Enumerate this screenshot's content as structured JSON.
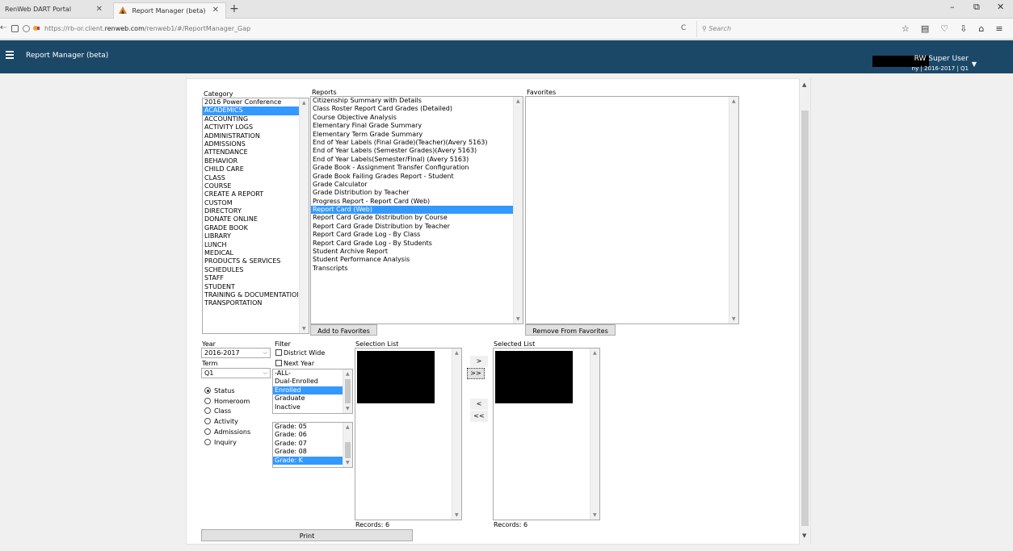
{
  "browser": {
    "tabs": [
      {
        "title": "RenWeb DART Portal"
      },
      {
        "title": "Report Manager (beta)"
      }
    ],
    "new_tab": "+",
    "url_prefix": "https://rb-or.client.",
    "url_domain": "renweb.com",
    "url_rest": "/renweb1/#/ReportManager_Gap",
    "reload": "C",
    "search_placeholder": "Search",
    "window_buttons": {
      "minimize": "–",
      "restore": "⧉",
      "close": "✕"
    }
  },
  "app": {
    "title": "Report Manager (beta)",
    "user_name": "RW Super User",
    "user_sub": "ny | 2016-2017 | Q1"
  },
  "category": {
    "label": "Category",
    "items": [
      "2016 Power Conference",
      "ACADEMICS",
      "ACCOUNTING",
      "ACTIVITY LOGS",
      "ADMINISTRATION",
      "ADMISSIONS",
      "ATTENDANCE",
      "BEHAVIOR",
      "CHILD CARE",
      "CLASS",
      "COURSE",
      "CREATE A REPORT",
      "CUSTOM",
      "DIRECTORY",
      "DONATE ONLINE",
      "GRADE BOOK",
      "LIBRARY",
      "LUNCH",
      "MEDICAL",
      "PRODUCTS & SERVICES",
      "SCHEDULES",
      "STAFF",
      "STUDENT",
      "TRAINING & DOCUMENTATIOI",
      "TRANSPORTATION"
    ],
    "selected": "ACADEMICS"
  },
  "reports": {
    "label": "Reports",
    "items": [
      "Citizenship Summary with Details",
      "Class Roster Report Card Grades (Detailed)",
      "Course Objective Analysis",
      "Elementary Final Grade Summary",
      "Elementary Term Grade Summary",
      "End of Year Labels (Final Grade)(Teacher)(Avery 5163)",
      "End of Year Labels (Semester Grades)(Avery 5163)",
      "End of Year Labels(Semester/Final) (Avery 5163)",
      "Grade Book - Assignment Transfer Configuration",
      "Grade Book Failing Grades Report - Student",
      "Grade Calculator",
      "Grade Distribution by Teacher",
      "Progress Report - Report Card (Web)",
      "Report Card (Web)",
      "Report Card Grade Distribution by Course",
      "Report Card Grade Distribution by Teacher",
      "Report Card Grade Log - By Class",
      "Report Card Grade Log - By Students",
      "Student Archive Report",
      "Student Performance Analysis",
      "Transcripts"
    ],
    "selected": "Report Card (Web)",
    "add_button": "Add to Favorites"
  },
  "favorites": {
    "label": "Favorites",
    "remove_button": "Remove From Favorites"
  },
  "year": {
    "label": "Year",
    "value": "2016-2017"
  },
  "term": {
    "label": "Term",
    "value": "Q1"
  },
  "filter": {
    "label": "Filter",
    "district_wide": "District Wide",
    "next_year": "Next Year",
    "status_items": [
      "-ALL-",
      "Dual-Enrolled",
      "Enrolled",
      "Graduate",
      "Inactive"
    ],
    "status_selected": "Enrolled",
    "grade_items": [
      "Grade: 05",
      "Grade: 06",
      "Grade: 07",
      "Grade: 08",
      "Grade: K"
    ],
    "grade_selected": "Grade: K"
  },
  "group_by": {
    "options": [
      "Status",
      "Homeroom",
      "Class",
      "Activity",
      "Admissions",
      "Inquiry"
    ],
    "selected": "Status"
  },
  "selection_list": {
    "label": "Selection List",
    "records": "Records: 6"
  },
  "selected_list": {
    "label": "Selected List",
    "records": "Records: 6"
  },
  "move_buttons": {
    "add": ">",
    "add_all": ">>",
    "remove": "<",
    "remove_all": "<<"
  },
  "print_button": "Print",
  "colors": {
    "header_bg": "#1c4868",
    "selection": "#3399ff"
  }
}
